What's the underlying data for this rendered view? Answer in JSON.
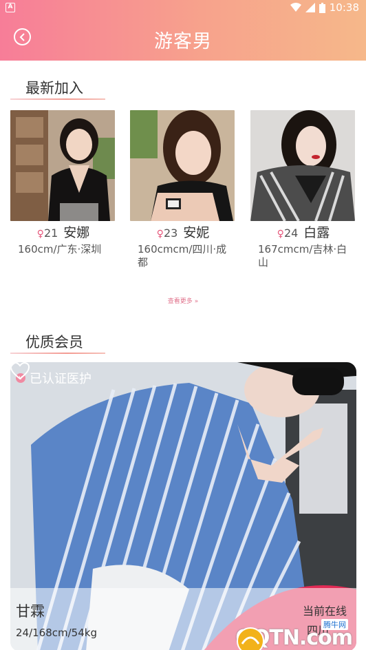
{
  "status_bar": {
    "time": "10:38"
  },
  "header": {
    "title": "游客男"
  },
  "newest": {
    "title": "最新加入",
    "more_label": "查看更多",
    "members": [
      {
        "age": "21",
        "name": "安娜",
        "info": "160cm/广东·深圳"
      },
      {
        "age": "23",
        "name": "安妮",
        "info": "160cmcm/四川·成都"
      },
      {
        "age": "24",
        "name": "白露",
        "info": "167cmcm/吉林·白山"
      }
    ]
  },
  "quality": {
    "title": "优质会员",
    "featured": {
      "badge": "已认证医护",
      "name": "甘霖",
      "info": "24/168cm/54kg",
      "status": "当前在线",
      "location": "四川"
    }
  },
  "watermark": {
    "text": "QQTN.com",
    "sub": "腾牛网"
  },
  "colors": {
    "accent": "#f77d98",
    "female": "#e6577b"
  },
  "icons": {
    "back": "back-circle-icon",
    "female": "female-icon",
    "heart": "heart-outline-icon",
    "more": "double-chevron-right-icon",
    "badge": "verified-badge-icon"
  }
}
